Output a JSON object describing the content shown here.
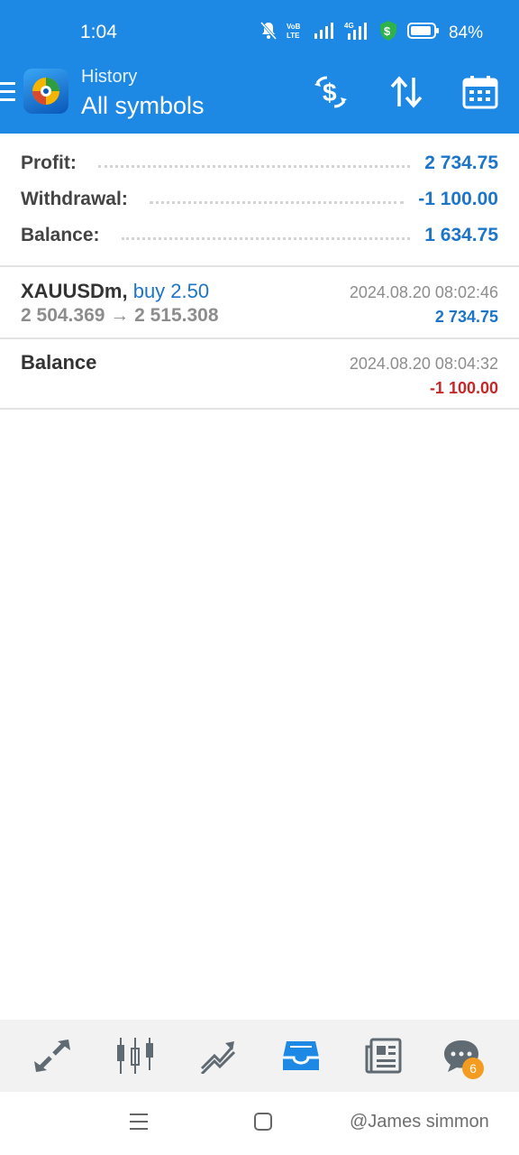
{
  "status_bar": {
    "time": "1:04",
    "battery_percent": "84%",
    "icons": [
      "mute-bell-icon",
      "volte-icon",
      "signal-icon",
      "4g-signal-icon",
      "dollar-shield-icon",
      "battery-icon"
    ]
  },
  "header": {
    "subtitle": "History",
    "title": "All symbols",
    "actions": [
      "currency-exchange-icon",
      "sort-icon",
      "calendar-icon"
    ]
  },
  "summary": {
    "profit": {
      "label": "Profit:",
      "value": "2 734.75"
    },
    "withdrawal": {
      "label": "Withdrawal:",
      "value": "-1 100.00"
    },
    "balance": {
      "label": "Balance:",
      "value": "1 634.75"
    }
  },
  "history": [
    {
      "symbol": "XAUUSDm,",
      "type": "buy 2.50",
      "prices": "2 504.369 → 2 515.308",
      "date": "2024.08.20 08:02:46",
      "profit": "2 734.75"
    },
    {
      "symbol": "Balance",
      "date": "2024.08.20 08:04:32",
      "profit": "-1 100.00"
    }
  ],
  "bottom_nav": {
    "items": [
      "quotes-icon",
      "charts-icon",
      "trade-icon",
      "history-icon",
      "news-icon",
      "chat-icon"
    ],
    "active": "history-icon",
    "chat_badge": "6"
  },
  "system_nav": [
    "menu-icon",
    "home-icon"
  ],
  "watermark": "@James simmon",
  "colors": {
    "primary": "#1e88e5",
    "positive": "#1c75c8",
    "negative": "#c62828",
    "badge": "#f39c1f"
  }
}
